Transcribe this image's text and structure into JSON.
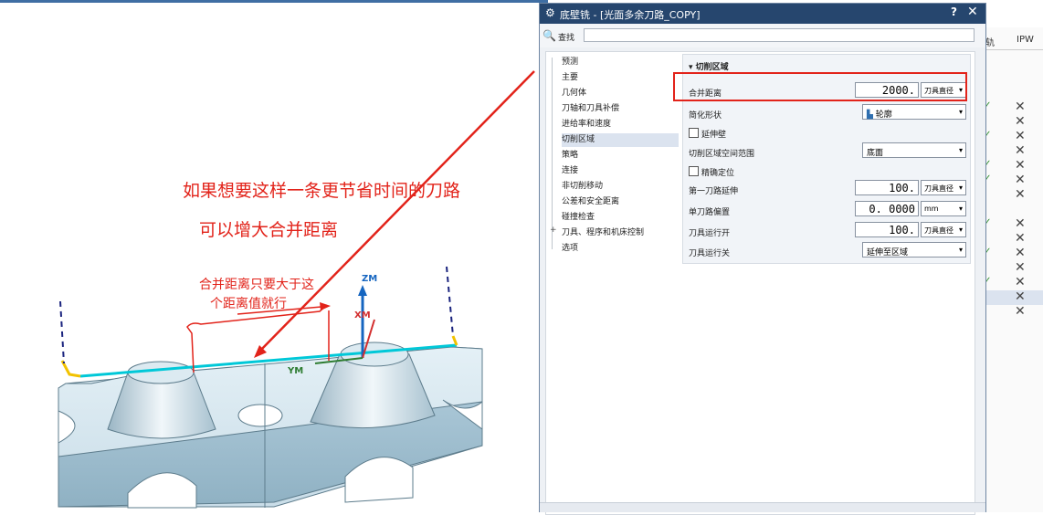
{
  "dialog": {
    "title": "底壁铣 - [光面多余刀路_COPY]",
    "help": "?",
    "close": "✕",
    "search_label": "查找",
    "search_value": ""
  },
  "nav": {
    "items": [
      "预测",
      "主要",
      "几何体",
      "刀轴和刀具补偿",
      "进给率和速度",
      "切削区域",
      "策略",
      "连接",
      "非切削移动",
      "公差和安全距离",
      "碰撞检查",
      "刀具、程序和机床控制",
      "选项"
    ],
    "selected": "切削区域"
  },
  "cut_region": {
    "header": "切削区域",
    "merge_distance": {
      "label": "合并距离",
      "value": "2000. 0000",
      "unit": "刀具直径"
    },
    "simplify_shape": {
      "label": "简化形状",
      "value": "轮廓"
    },
    "extend_wall": {
      "label": "延伸壁",
      "checked": false
    },
    "space_range": {
      "label": "切削区域空间范围",
      "value": "底面"
    },
    "precise_locate": {
      "label": "精确定位",
      "checked": false
    },
    "first_path_extend": {
      "label": "第一刀路延伸",
      "value": "100. 0000",
      "unit": "刀具直径"
    },
    "single_path_offset": {
      "label": "单刀路偏置",
      "value": "0. 0000",
      "unit": "mm"
    },
    "tool_run_on": {
      "label": "刀具运行开",
      "value": "100. 0000",
      "unit": "刀具直径"
    },
    "tool_run_off": {
      "label": "刀具运行关",
      "value": "延伸至区域"
    }
  },
  "background_table": {
    "col1": "轨",
    "col2": "IPW"
  },
  "annotations": {
    "main": "如果想要这样一条更节省时间的刀路",
    "sub": "可以增大合并距离",
    "note_line1": "合并距离只要大于这",
    "note_line2": "个距离值就行"
  },
  "axes": {
    "zm": "ZM",
    "xm": "XM",
    "ym": "YM"
  },
  "colors": {
    "title_bar": "#26466e",
    "annotation": "#e2231a",
    "toolpath": "#00c8d8"
  }
}
